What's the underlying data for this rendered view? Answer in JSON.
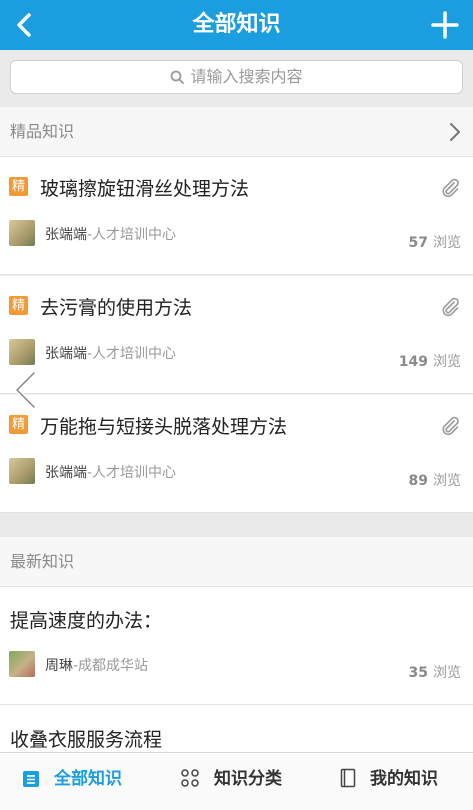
{
  "header": {
    "title": "全部知识",
    "back_icon": "chevron-left-icon",
    "add_icon": "plus-icon"
  },
  "search": {
    "placeholder": "请输入搜索内容"
  },
  "featured": {
    "heading": "精品知识",
    "items": [
      {
        "badge": "精",
        "title": "玻璃擦旋钮滑丝处理方法",
        "author": "张端端",
        "dept": "-人才培训中心",
        "views": "57",
        "views_label": "浏览"
      },
      {
        "badge": "精",
        "title": "去污膏的使用方法",
        "author": "张端端",
        "dept": "-人才培训中心",
        "views": "149",
        "views_label": "浏览"
      },
      {
        "badge": "精",
        "title": "万能拖与短接头脱落处理方法",
        "author": "张端端",
        "dept": "-人才培训中心",
        "views": "89",
        "views_label": "浏览"
      }
    ]
  },
  "latest": {
    "heading": "最新知识",
    "items": [
      {
        "title": "提高速度的办法：",
        "author": "周琳",
        "dept": "-成都成华站",
        "views": "35",
        "views_label": "浏览"
      },
      {
        "title": "收叠衣服服务流程"
      }
    ]
  },
  "tabs": [
    {
      "label": "全部知识",
      "icon": "list-icon",
      "active": true
    },
    {
      "label": "知识分类",
      "icon": "grid-icon",
      "active": false
    },
    {
      "label": "我的知识",
      "icon": "book-icon",
      "active": false
    }
  ],
  "colors": {
    "accent": "#1b9ee0",
    "badge": "#f39a34"
  }
}
